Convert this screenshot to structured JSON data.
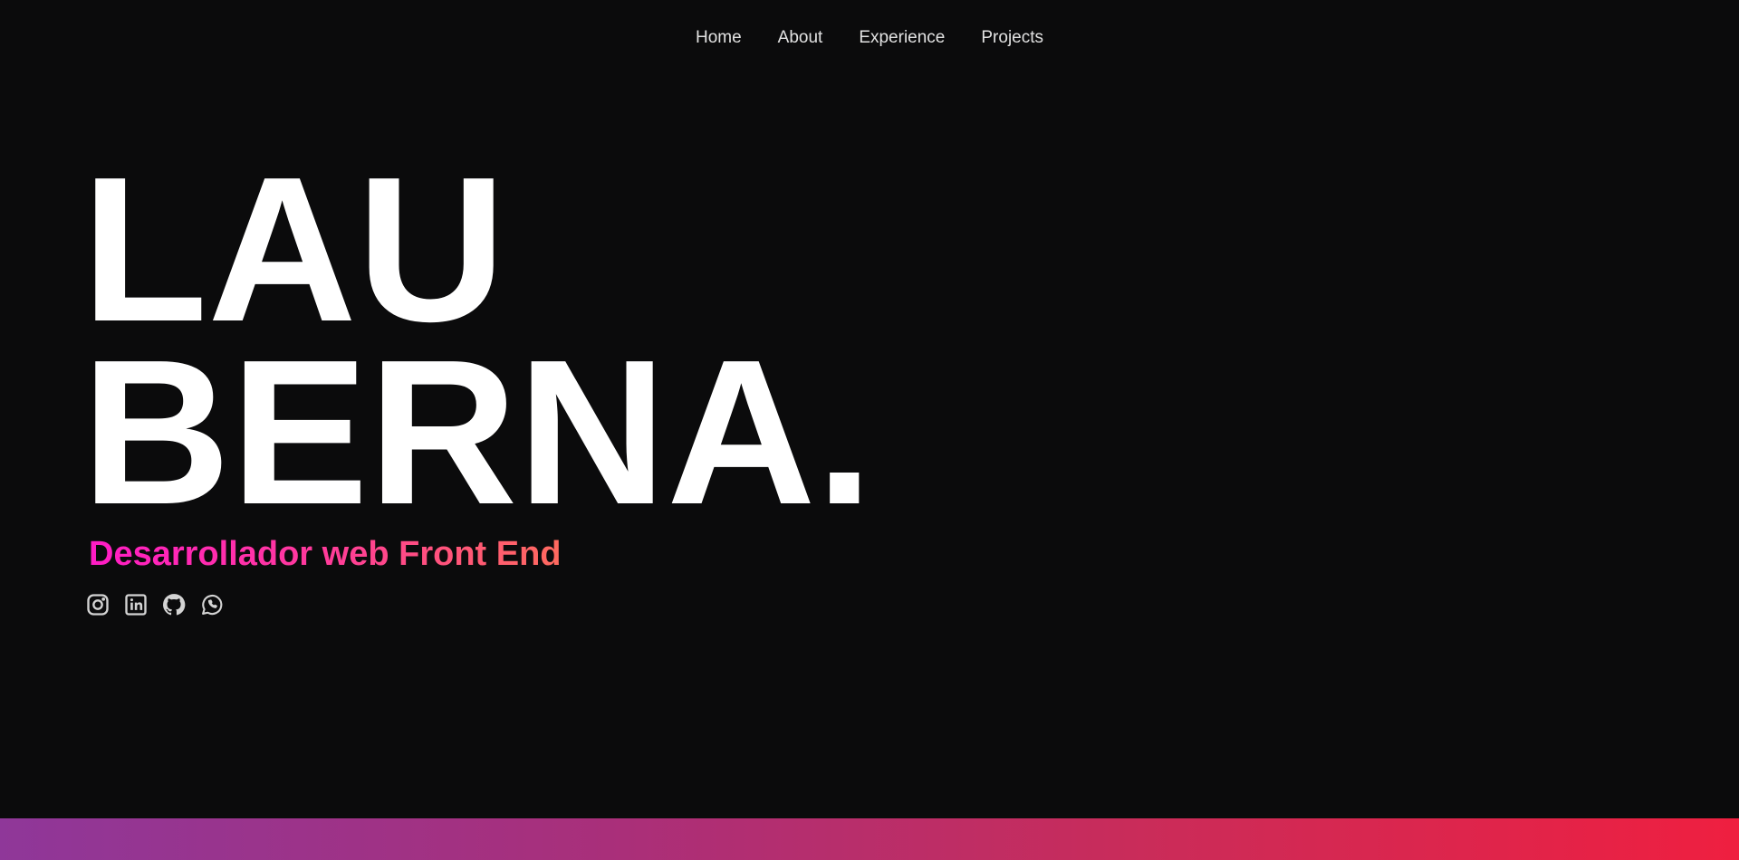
{
  "nav": {
    "items": [
      {
        "label": "Home"
      },
      {
        "label": "About"
      },
      {
        "label": "Experience"
      },
      {
        "label": "Projects"
      }
    ]
  },
  "hero": {
    "name_line1": "LAU",
    "name_line2": "BERNA.",
    "subtitle": "Desarrollador web Front End"
  },
  "socials": [
    {
      "icon": "instagram-icon"
    },
    {
      "icon": "linkedin-icon"
    },
    {
      "icon": "github-icon"
    },
    {
      "icon": "whatsapp-icon"
    }
  ],
  "colors": {
    "background": "#0b0b0c",
    "nav_text": "#e2e2e2",
    "title_text": "#ffffff",
    "icon": "#d4d4d4",
    "subtitle_gradient": [
      "#ff1cc6",
      "#ff6a5e"
    ],
    "footer_gradient": [
      "#8f3799",
      "#ef1f40"
    ]
  }
}
